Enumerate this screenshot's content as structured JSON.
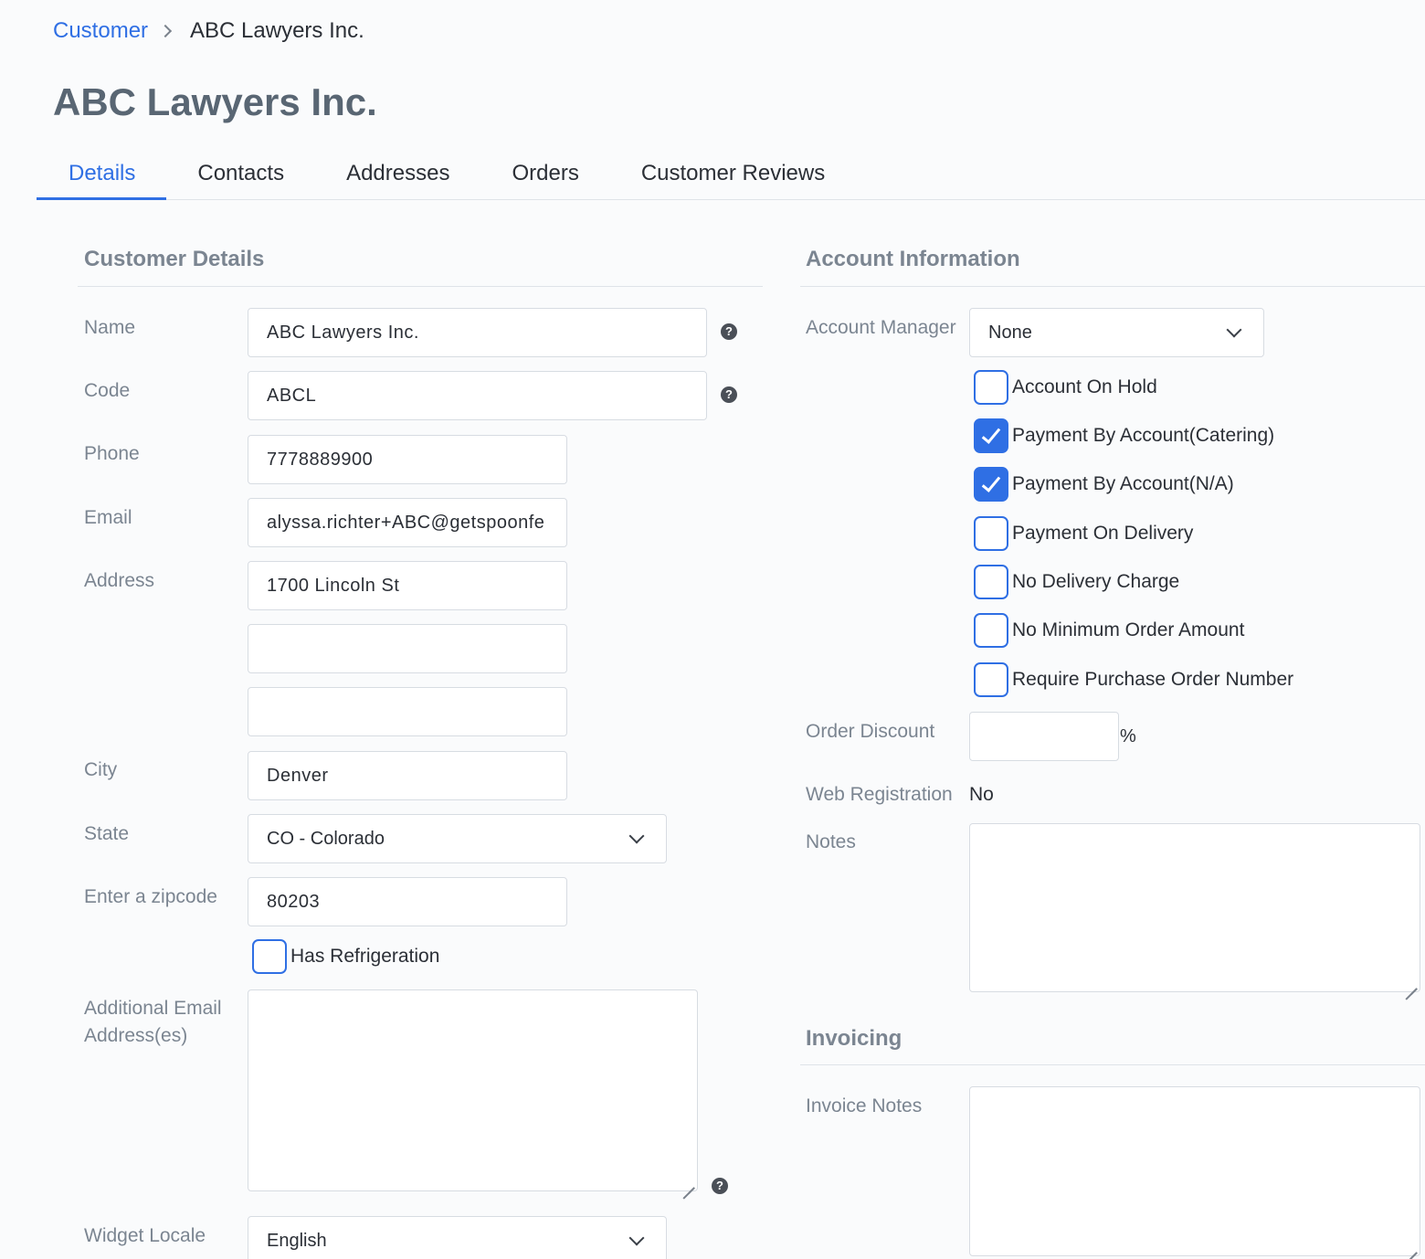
{
  "breadcrumb": {
    "parent": "Customer",
    "current": "ABC Lawyers Inc."
  },
  "page_title": "ABC Lawyers Inc.",
  "tabs": [
    {
      "label": "Details",
      "active": true
    },
    {
      "label": "Contacts"
    },
    {
      "label": "Addresses"
    },
    {
      "label": "Orders"
    },
    {
      "label": "Customer Reviews"
    }
  ],
  "customer_details": {
    "title": "Customer Details",
    "name": {
      "label": "Name",
      "value": "ABC Lawyers Inc."
    },
    "code": {
      "label": "Code",
      "value": "ABCL"
    },
    "phone": {
      "label": "Phone",
      "value": "7778889900"
    },
    "email": {
      "label": "Email",
      "value": "alyssa.richter+ABC@getspoonfe"
    },
    "address": {
      "label": "Address",
      "line1": "1700 Lincoln St",
      "line2": "",
      "line3": ""
    },
    "city": {
      "label": "City",
      "value": "Denver"
    },
    "state": {
      "label": "State",
      "value": "CO - Colorado"
    },
    "zipcode": {
      "label": "Enter a zipcode",
      "value": "80203"
    },
    "has_refrigeration": {
      "label": "Has Refrigeration",
      "checked": false
    },
    "additional_email": {
      "label_line1": "Additional Email",
      "label_line2": "Address(es)",
      "value": ""
    },
    "widget_locale": {
      "label": "Widget Locale",
      "value": "English"
    }
  },
  "account_information": {
    "title": "Account Information",
    "account_manager": {
      "label": "Account Manager",
      "value": "None"
    },
    "flags": [
      {
        "label": "Account On Hold",
        "checked": false
      },
      {
        "label": "Payment By Account(Catering)",
        "checked": true
      },
      {
        "label": "Payment By Account(N/A)",
        "checked": true
      },
      {
        "label": "Payment On Delivery",
        "checked": false
      },
      {
        "label": "No Delivery Charge",
        "checked": false
      },
      {
        "label": "No Minimum Order Amount",
        "checked": false
      },
      {
        "label": "Require Purchase Order Number",
        "checked": false
      }
    ],
    "order_discount": {
      "label": "Order Discount",
      "value": "",
      "unit": "%"
    },
    "web_registration": {
      "label": "Web Registration",
      "value": "No"
    },
    "notes": {
      "label": "Notes",
      "value": ""
    }
  },
  "invoicing": {
    "title": "Invoicing",
    "invoice_notes": {
      "label": "Invoice Notes",
      "value": ""
    }
  },
  "colors": {
    "accent": "#2f6fe4",
    "muted_label": "#7b8591",
    "title": "#596673"
  },
  "icons": {
    "help": "question-circle-icon",
    "breadcrumb_separator": "chevron-right-icon",
    "dropdown": "chevron-down-icon"
  }
}
